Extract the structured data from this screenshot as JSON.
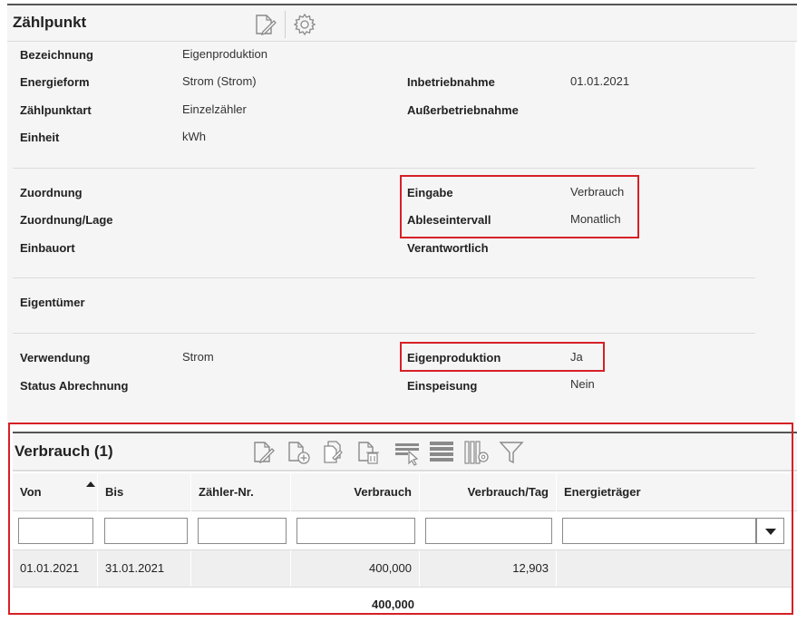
{
  "zaehlpunkt": {
    "title": "Zählpunkt",
    "icons": [
      "edit-document-icon",
      "gear-icon"
    ],
    "fields": {
      "bezeichnung": {
        "label": "Bezeichnung",
        "value": "Eigenproduktion"
      },
      "energieform": {
        "label": "Energieform",
        "value": "Strom (Strom)"
      },
      "inbetriebnahme": {
        "label": "Inbetriebnahme",
        "value": "01.01.2021"
      },
      "zaehlpunktart": {
        "label": "Zählpunktart",
        "value": "Einzelzähler"
      },
      "ausserbetriebnahme": {
        "label": "Außerbetriebnahme",
        "value": ""
      },
      "einheit": {
        "label": "Einheit",
        "value": "kWh"
      },
      "zuordnung": {
        "label": "Zuordnung",
        "value": ""
      },
      "eingabe": {
        "label": "Eingabe",
        "value": "Verbrauch"
      },
      "zuordnung_lage": {
        "label": "Zuordnung/Lage",
        "value": ""
      },
      "ableseintervall": {
        "label": "Ableseintervall",
        "value": "Monatlich"
      },
      "einbauort": {
        "label": "Einbauort",
        "value": ""
      },
      "verantwortlich": {
        "label": "Verantwortlich",
        "value": ""
      },
      "eigentuemer": {
        "label": "Eigentümer",
        "value": ""
      },
      "verwendung": {
        "label": "Verwendung",
        "value": "Strom"
      },
      "eigenproduktion": {
        "label": "Eigenproduktion",
        "value": "Ja"
      },
      "status_abrechnung": {
        "label": "Status Abrechnung",
        "value": ""
      },
      "einspeisung": {
        "label": "Einspeisung",
        "value": "Nein"
      }
    }
  },
  "verbrauch": {
    "title": "Verbrauch (1)",
    "toolbar_icons": [
      "edit-icon",
      "add-document-icon",
      "copy-document-icon",
      "delete-document-icon",
      "select-rows-icon",
      "list-view-icon",
      "column-settings-icon",
      "filter-icon"
    ],
    "columns": [
      "Von",
      "Bis",
      "Zähler-Nr.",
      "Verbrauch",
      "Verbrauch/Tag",
      "Energieträger"
    ],
    "sort_column": "Von",
    "rows": [
      {
        "von": "01.01.2021",
        "bis": "31.01.2021",
        "zaehler_nr": "",
        "verbrauch": "400,000",
        "verbrauch_tag": "12,903",
        "energietraeger": ""
      }
    ],
    "total_verbrauch": "400,000"
  },
  "colors": {
    "highlight": "#d62027",
    "panel": "#f5f5f5",
    "row": "#efefef"
  }
}
